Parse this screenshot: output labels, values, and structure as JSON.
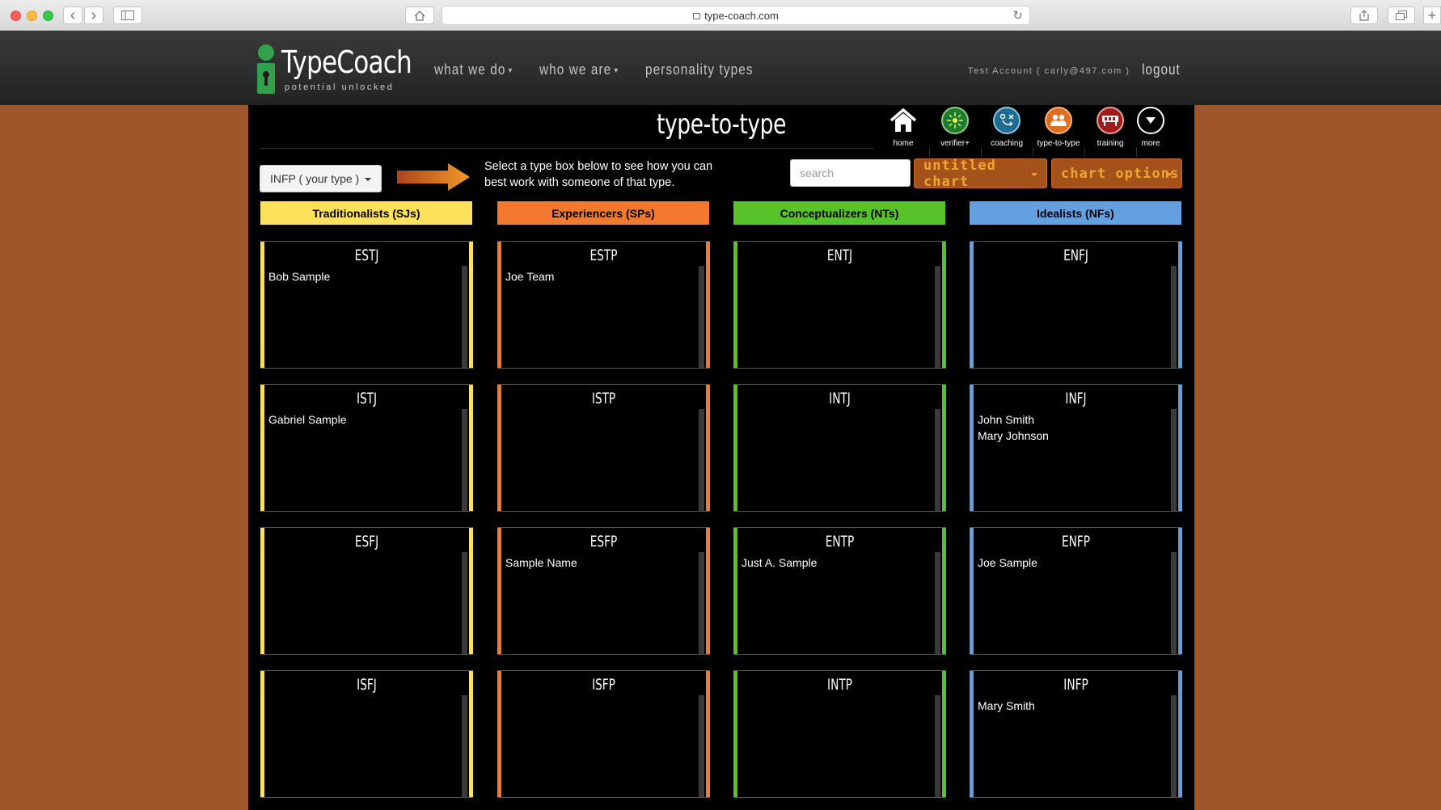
{
  "browser": {
    "url": "type-coach.com",
    "reload_glyph": "↻",
    "back_glyph": "‹",
    "forward_glyph": "›",
    "new_tab_glyph": "+"
  },
  "header": {
    "logo_text": "TypeCoach",
    "tagline": "potential unlocked",
    "nav": {
      "what_we_do": "what we do",
      "who_we_are": "who we are",
      "personality_types": "personality types"
    },
    "account": "Test Account ( carly@497.com )",
    "logout": "logout"
  },
  "page": {
    "title": "type-to-type",
    "tools": {
      "home": "home",
      "verifier": "verifier+",
      "coaching": "coaching",
      "type_to_type": "type-to-type",
      "training": "training",
      "more": "more"
    },
    "type_select": "INFP ( your type )",
    "instructions": "Select a type box below to see how you can best work with someone of that type.",
    "search_placeholder": "search",
    "chart_name": "untitled chart",
    "chart_options": "chart options"
  },
  "colors": {
    "sj": "#fde15a",
    "sp": "#f2792e",
    "nt": "#57c22a",
    "nf": "#64a0e0",
    "button_text": "#f0a535",
    "page_bg": "#a0562a"
  },
  "columns": [
    {
      "label": "Traditionalists (SJs)",
      "boxes": [
        {
          "type": "ESTJ",
          "names": [
            "Bob Sample"
          ]
        },
        {
          "type": "ISTJ",
          "names": [
            "Gabriel Sample"
          ]
        },
        {
          "type": "ESFJ",
          "names": []
        },
        {
          "type": "ISFJ",
          "names": []
        }
      ]
    },
    {
      "label": "Experiencers (SPs)",
      "boxes": [
        {
          "type": "ESTP",
          "names": [
            "Joe Team"
          ]
        },
        {
          "type": "ISTP",
          "names": []
        },
        {
          "type": "ESFP",
          "names": [
            "Sample Name"
          ]
        },
        {
          "type": "ISFP",
          "names": []
        }
      ]
    },
    {
      "label": "Conceptualizers (NTs)",
      "boxes": [
        {
          "type": "ENTJ",
          "names": []
        },
        {
          "type": "INTJ",
          "names": []
        },
        {
          "type": "ENTP",
          "names": [
            "Just A. Sample"
          ]
        },
        {
          "type": "INTP",
          "names": []
        }
      ]
    },
    {
      "label": "Idealists (NFs)",
      "boxes": [
        {
          "type": "ENFJ",
          "names": []
        },
        {
          "type": "INFJ",
          "names": [
            "John Smith",
            "Mary Johnson"
          ]
        },
        {
          "type": "ENFP",
          "names": [
            "Joe Sample"
          ]
        },
        {
          "type": "INFP",
          "names": [
            "Mary Smith"
          ]
        }
      ]
    }
  ]
}
